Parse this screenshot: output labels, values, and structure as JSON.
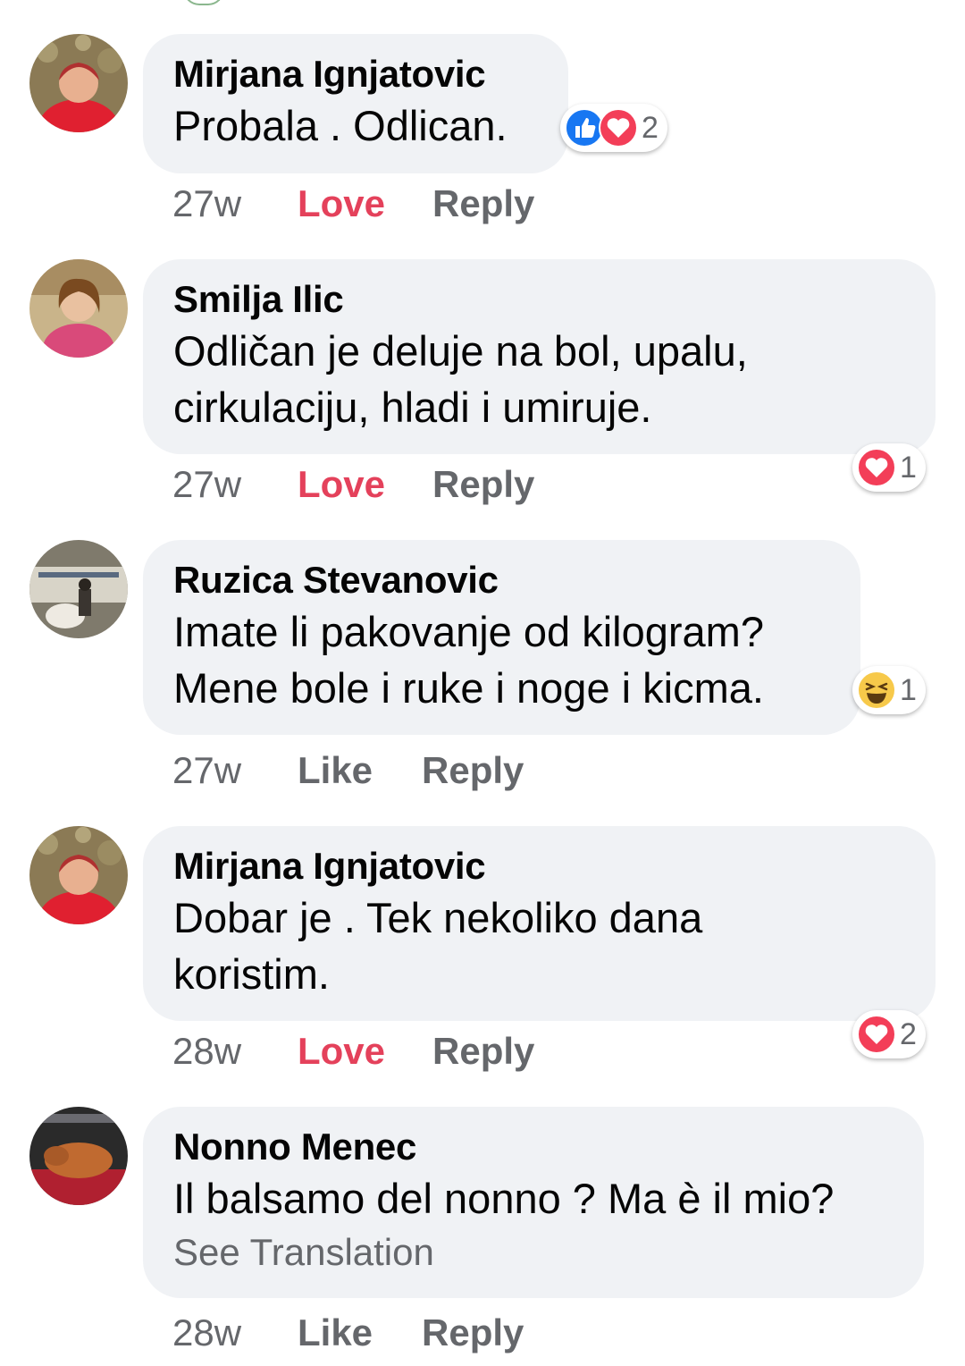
{
  "comments": [
    {
      "author": "Mirjana Ignjatovic",
      "lines": [
        "Probala . Odlican."
      ],
      "time": "27w",
      "like_label": "Love",
      "reply_label": "Reply",
      "reactions": {
        "icons": [
          "like-icon",
          "love-icon"
        ],
        "count": "2"
      }
    },
    {
      "author": "Smilja Ilic",
      "lines": [
        "Odličan je deluje na bol, upalu,",
        "cirkulaciju, hladi i umiruje."
      ],
      "time": "27w",
      "like_label": "Love",
      "reply_label": "Reply",
      "reactions": {
        "icons": [
          "love-icon"
        ],
        "count": "1"
      }
    },
    {
      "author": "Ruzica Stevanovic",
      "lines": [
        "Imate li pakovanje od kilogram?",
        "Mene bole i ruke i noge i kicma."
      ],
      "time": "27w",
      "like_label": "Like",
      "reply_label": "Reply",
      "reactions": {
        "icons": [
          "haha-icon"
        ],
        "count": "1"
      }
    },
    {
      "author": "Mirjana Ignjatovic",
      "lines": [
        "Dobar je . Tek nekoliko dana",
        "koristim."
      ],
      "time": "28w",
      "like_label": "Love",
      "reply_label": "Reply",
      "reactions": {
        "icons": [
          "love-icon"
        ],
        "count": "2"
      }
    },
    {
      "author": "Nonno Menec",
      "lines": [
        "Il balsamo del nonno ? Ma è il mio?"
      ],
      "see_translation": "See Translation",
      "time": "28w",
      "like_label": "Like",
      "reply_label": "Reply"
    }
  ],
  "colors": {
    "bubble": "#f0f2f5",
    "love": "#e4415b",
    "meta": "#65676b",
    "like_blue": "#1877f2"
  }
}
